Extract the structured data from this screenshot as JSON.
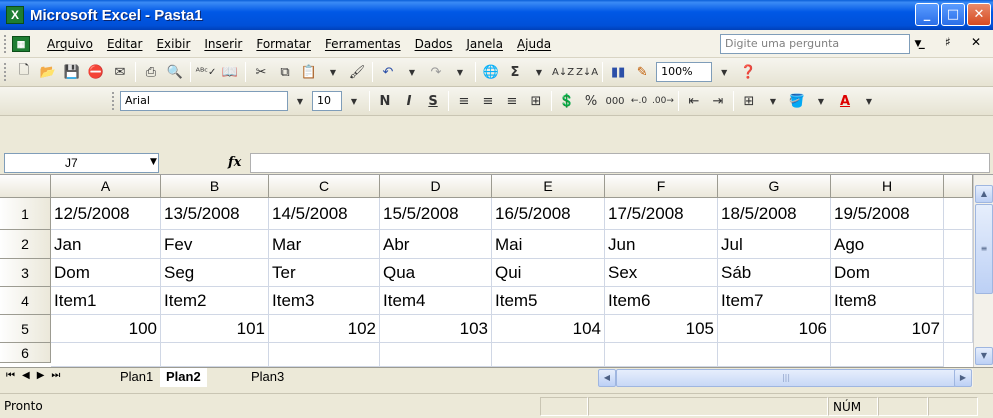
{
  "window": {
    "title": "Microsoft Excel - Pasta1",
    "app_icon": "X",
    "minimize": "_",
    "maximize": "□",
    "close": "✕"
  },
  "menubar": {
    "items": [
      "Arquivo",
      "Editar",
      "Exibir",
      "Inserir",
      "Formatar",
      "Ferramentas",
      "Dados",
      "Janela",
      "Ajuda"
    ],
    "ask_placeholder": "Digite uma pergunta",
    "doc_controls": "_ ♯ ✕"
  },
  "toolbar_standard": {
    "zoom": "100%"
  },
  "toolbar_format": {
    "font": "Arial",
    "size": "10",
    "bold": "N",
    "italic": "I",
    "underline": "S",
    "percent": "%",
    "thousands": "000"
  },
  "formula_bar": {
    "name_box": "J7",
    "fx": "fx",
    "content": ""
  },
  "grid": {
    "columns": [
      "A",
      "B",
      "C",
      "D",
      "E",
      "F",
      "G",
      "H"
    ],
    "rows": [
      "1",
      "2",
      "3",
      "4",
      "5",
      "6"
    ],
    "cells": [
      [
        "12/5/2008",
        "13/5/2008",
        "14/5/2008",
        "15/5/2008",
        "16/5/2008",
        "17/5/2008",
        "18/5/2008",
        "19/5/2008"
      ],
      [
        "Jan",
        "Fev",
        "Mar",
        "Abr",
        "Mai",
        "Jun",
        "Jul",
        "Ago"
      ],
      [
        "Dom",
        "Seg",
        "Ter",
        "Qua",
        "Qui",
        "Sex",
        "Sáb",
        "Dom"
      ],
      [
        "Item1",
        "Item2",
        "Item3",
        "Item4",
        "Item5",
        "Item6",
        "Item7",
        "Item8"
      ],
      [
        "100",
        "101",
        "102",
        "103",
        "104",
        "105",
        "106",
        "107"
      ],
      [
        "",
        "",
        "",
        "",
        "",
        "",
        "",
        ""
      ]
    ]
  },
  "sheets": {
    "tabs": [
      "Plan1",
      "Plan2",
      "Plan3"
    ],
    "active": "Plan2"
  },
  "status": {
    "text": "Pronto",
    "num": "NÚM"
  }
}
